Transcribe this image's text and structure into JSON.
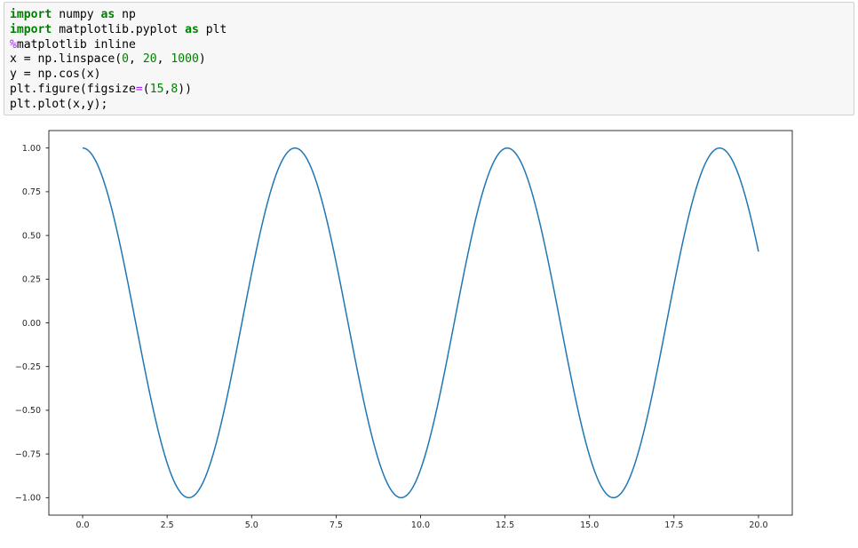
{
  "notebook": {
    "cell": {
      "code_lines": [
        [
          {
            "t": "import",
            "c": "kw"
          },
          {
            "t": " numpy ",
            "c": "plain"
          },
          {
            "t": "as",
            "c": "kw"
          },
          {
            "t": " np",
            "c": "plain"
          }
        ],
        [
          {
            "t": "import",
            "c": "kw"
          },
          {
            "t": " matplotlib.pyplot ",
            "c": "plain"
          },
          {
            "t": "as",
            "c": "kw"
          },
          {
            "t": " plt",
            "c": "plain"
          }
        ],
        [
          {
            "t": "%",
            "c": "magic"
          },
          {
            "t": "matplotlib inline",
            "c": "plain"
          }
        ],
        [
          {
            "t": "x = np.linspace(",
            "c": "plain"
          },
          {
            "t": "0",
            "c": "num"
          },
          {
            "t": ", ",
            "c": "plain"
          },
          {
            "t": "20",
            "c": "num"
          },
          {
            "t": ", ",
            "c": "plain"
          },
          {
            "t": "1000",
            "c": "num"
          },
          {
            "t": ")",
            "c": "plain"
          }
        ],
        [
          {
            "t": "y = np.cos(x)",
            "c": "plain"
          }
        ],
        [
          {
            "t": "plt.figure(figsize",
            "c": "plain"
          },
          {
            "t": "=",
            "c": "op"
          },
          {
            "t": "(",
            "c": "plain"
          },
          {
            "t": "15",
            "c": "num"
          },
          {
            "t": ",",
            "c": "plain"
          },
          {
            "t": "8",
            "c": "num"
          },
          {
            "t": "))",
            "c": "plain"
          }
        ],
        [
          {
            "t": "plt.plot(x,y);",
            "c": "plain"
          }
        ]
      ]
    }
  },
  "chart_data": {
    "type": "line",
    "function": "cos",
    "x": {
      "start": 0,
      "stop": 20,
      "num": 1000
    },
    "xlim": [
      -1.0,
      21.0
    ],
    "ylim": [
      -1.1,
      1.1
    ],
    "xticks": [
      0.0,
      2.5,
      5.0,
      7.5,
      10.0,
      12.5,
      15.0,
      17.5,
      20.0
    ],
    "xtick_labels": [
      "0.0",
      "2.5",
      "5.0",
      "7.5",
      "10.0",
      "12.5",
      "15.0",
      "17.5",
      "20.0"
    ],
    "yticks": [
      1.0,
      0.75,
      0.5,
      0.25,
      0.0,
      -0.25,
      -0.5,
      -0.75,
      -1.0
    ],
    "ytick_labels": [
      "1.00",
      "0.75",
      "0.50",
      "0.25",
      "0.00",
      "−0.25",
      "−0.50",
      "−0.75",
      "−1.00"
    ],
    "grid": false,
    "series": [
      {
        "color": "#1f77b4"
      }
    ]
  }
}
